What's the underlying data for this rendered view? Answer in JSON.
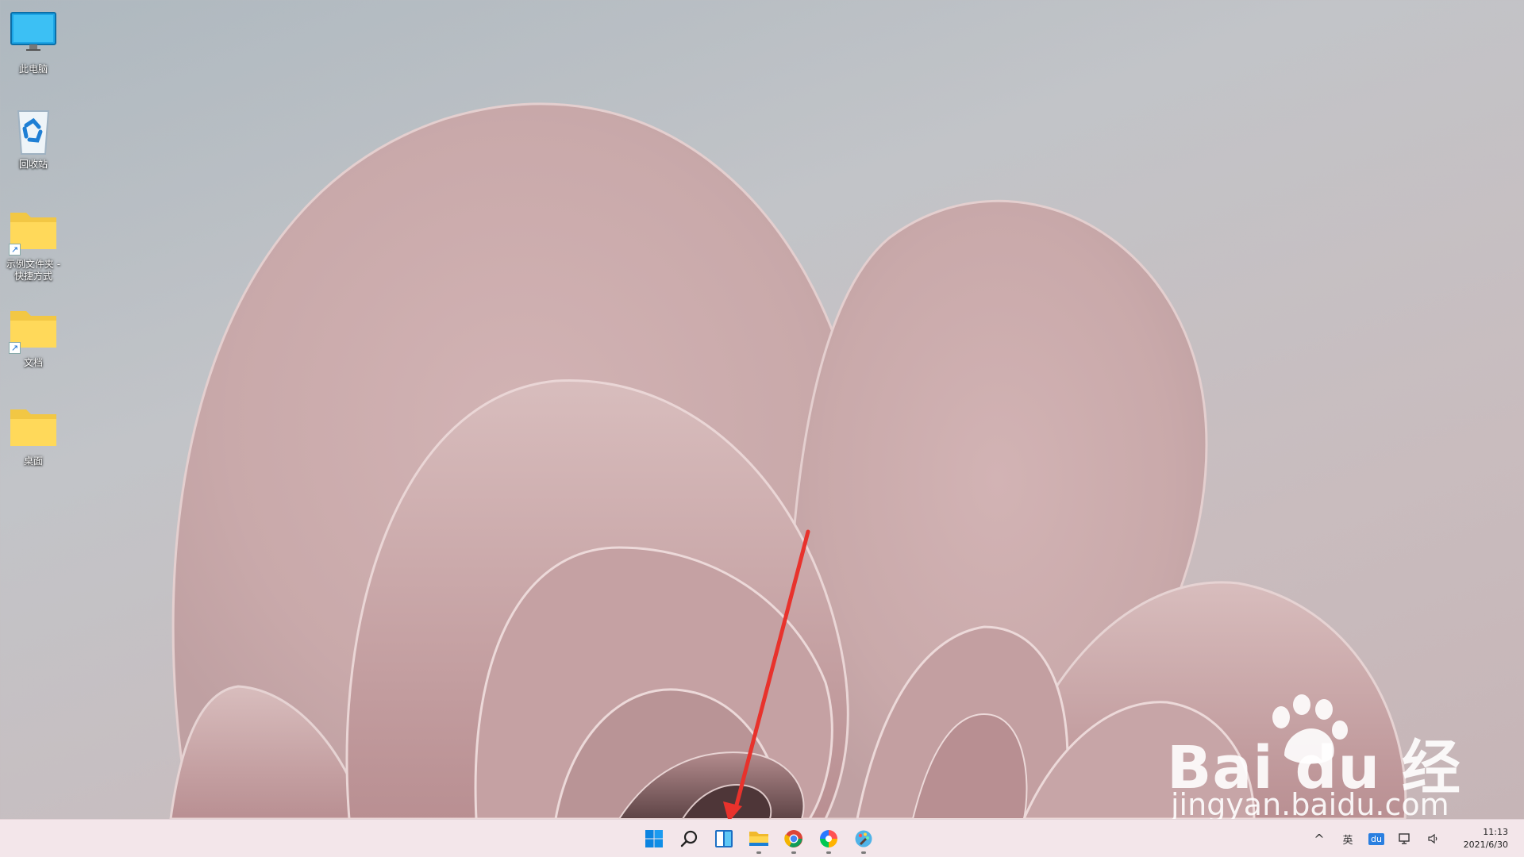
{
  "desktop": {
    "icons": [
      {
        "label": "此电脑"
      },
      {
        "label": "回收站"
      },
      {
        "label": "示例文件夹 - 快捷方式"
      },
      {
        "label": "文档"
      },
      {
        "label": "桌面"
      }
    ]
  },
  "watermark": {
    "main": "Bai  du 经验",
    "sub": "jingyan.baidu.com"
  },
  "taskbar": {
    "pinned": [
      "start-icon",
      "search-icon",
      "widgets-icon",
      "file-explorer-icon",
      "chrome-icon",
      "colorful-app-icon",
      "paint-app-icon"
    ],
    "tray": {
      "chevron": "^",
      "ime": "英",
      "baidu": "du"
    },
    "clock": {
      "time": "11:13",
      "date": "2021/6/30"
    }
  },
  "colors": {
    "accent": "#0078d4",
    "arrow": "#e8322c",
    "taskbar": "#f3e6ea"
  }
}
